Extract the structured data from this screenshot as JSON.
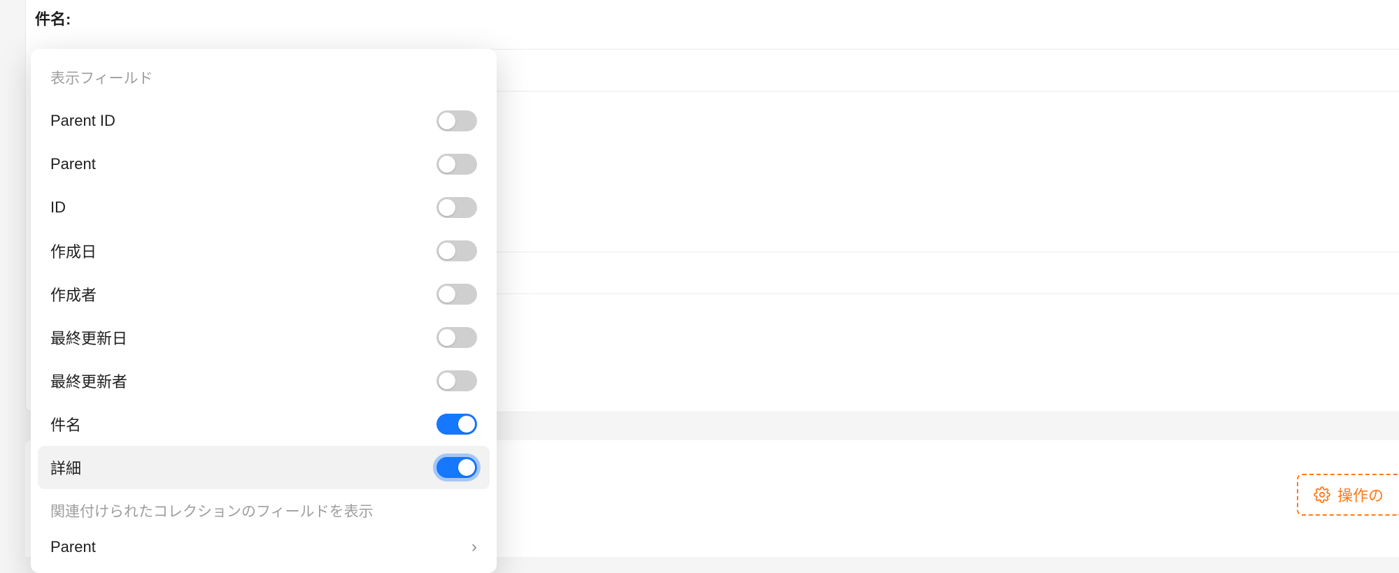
{
  "detail": {
    "title_label": "件名:"
  },
  "popover": {
    "section_title": "表示フィールド",
    "fields": [
      {
        "label": "Parent ID",
        "on": false,
        "highlight": false
      },
      {
        "label": "Parent",
        "on": false,
        "highlight": false
      },
      {
        "label": "ID",
        "on": false,
        "highlight": false
      },
      {
        "label": "作成日",
        "on": false,
        "highlight": false
      },
      {
        "label": "作成者",
        "on": false,
        "highlight": false
      },
      {
        "label": "最終更新日",
        "on": false,
        "highlight": false
      },
      {
        "label": "最終更新者",
        "on": false,
        "highlight": false
      },
      {
        "label": "件名",
        "on": true,
        "highlight": false
      },
      {
        "label": "詳細",
        "on": true,
        "highlight": true,
        "focus": true
      }
    ],
    "related_title": "関連付けられたコレクションのフィールドを表示",
    "submenu": {
      "label": "Parent"
    }
  },
  "action": {
    "button_label": "操作の"
  },
  "icons": {
    "gear": "gear-icon",
    "chevron_right": "›"
  }
}
